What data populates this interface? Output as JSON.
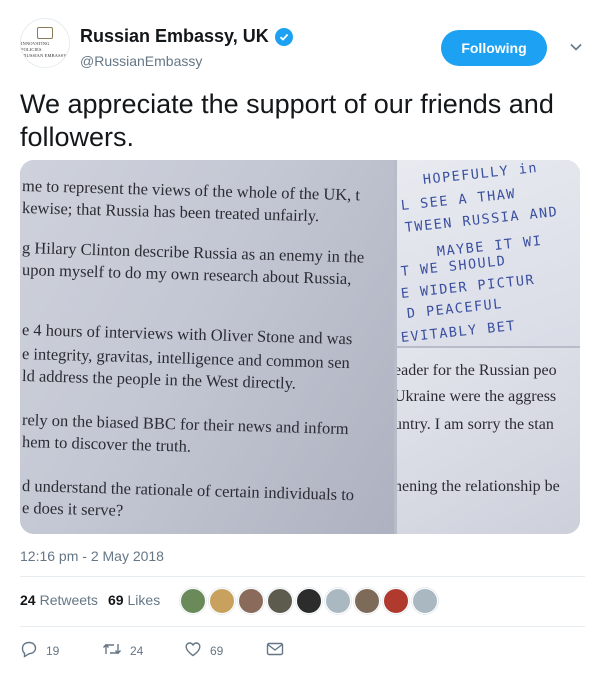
{
  "account": {
    "display_name": "Russian Embassy, UK",
    "handle": "@RussianEmbassy",
    "avatar_lines": [
      "INNOVATING POLICIES",
      "RUSSIAN EMBASSY"
    ]
  },
  "follow_button": {
    "label": "Following"
  },
  "tweet": {
    "text": "We appreciate the support of our friends and followers.",
    "timestamp": "12:16 pm - 2 May 2018"
  },
  "media": {
    "left_text": [
      "me to represent the views of the whole of the UK, t",
      "kewise; that Russia has been treated unfairly.",
      "g Hilary Clinton describe Russia as an enemy in the",
      "upon myself to do my own research about Russia,",
      "e 4 hours of interviews with Oliver Stone and was",
      "e integrity, gravitas, intelligence and common sen",
      "ld address the people in the West directly.",
      "rely on the biased BBC for their news and inform",
      "hem to discover the truth.",
      "d understand the rationale of certain individuals to",
      "e does it serve?"
    ],
    "handwriting": [
      "HOPEFULLY in",
      "L SEE A THAW",
      "TWEEN RUSSIA AND",
      "MAYBE IT WI",
      "T WE SHOULD",
      "E WIDER PICTUR",
      "D PEACEFUL",
      "EVITABLY BET"
    ],
    "right_bottom_text": [
      "eader for the Russian peo",
      "Ukraine were the aggress",
      "untry. I am sorry the stan",
      "hening the relationship be"
    ]
  },
  "stats": {
    "retweets_count": "24",
    "retweets_label": "Retweets",
    "likes_count": "69",
    "likes_label": "Likes"
  },
  "actions": {
    "reply_count": "19",
    "retweet_count": "24",
    "like_count": "69"
  },
  "colors": {
    "accent": "#1da1f2",
    "muted": "#657786",
    "text": "#14171a"
  },
  "likers": [
    "#6b8a5a",
    "#c9a15e",
    "#8a6b5b",
    "#5d5a4e",
    "#2c2c2c",
    "#aab8c2",
    "#7d6a58",
    "#b03a2e",
    "#aab8c2"
  ]
}
